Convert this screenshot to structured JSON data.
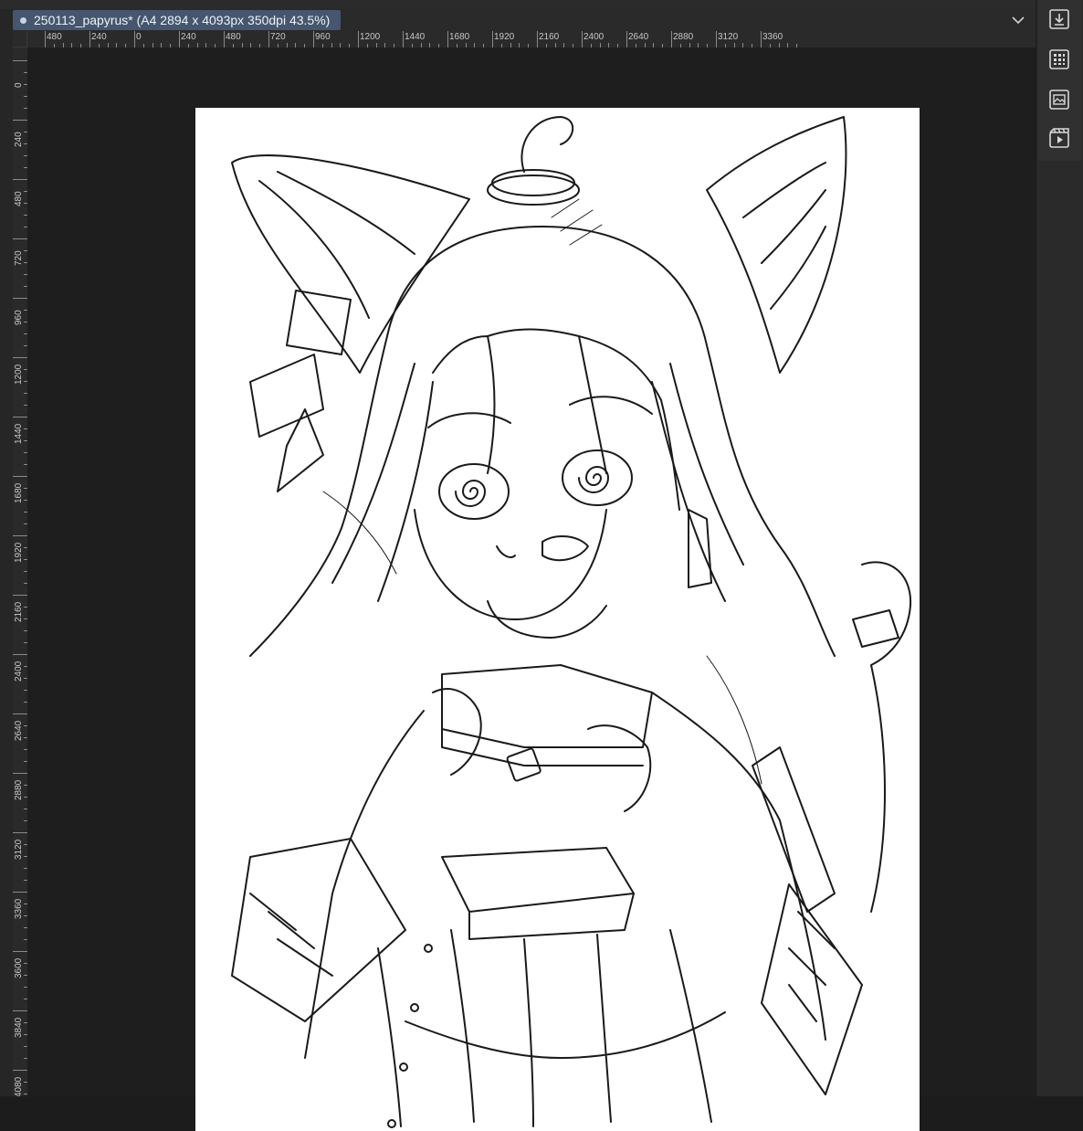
{
  "document_tab": {
    "title": "250113_papyrus* (A4 2894 x 4093px 350dpi 43.5%)"
  },
  "horizontal_ruler": {
    "labels": [
      "480",
      "240",
      "0",
      "240",
      "480",
      "720",
      "960",
      "1200",
      "1440",
      "1680",
      "1920",
      "2160",
      "2400",
      "2640",
      "2880",
      "3120",
      "3360"
    ]
  },
  "vertical_ruler": {
    "labels": [
      "0",
      "240",
      "480",
      "720",
      "960",
      "1200",
      "1440",
      "1680",
      "1920",
      "2160",
      "2400",
      "2640",
      "2880",
      "3120",
      "3360",
      "3600",
      "3840",
      "4080"
    ]
  },
  "right_panel": {
    "buttons": [
      "import-icon",
      "grid-icon",
      "image-panel-icon",
      "animation-icon"
    ]
  },
  "colors": {
    "background": "#1c1c1c",
    "tab_active": "#45566e",
    "paper": "#ffffff",
    "line_art": "#1a1a1a"
  }
}
